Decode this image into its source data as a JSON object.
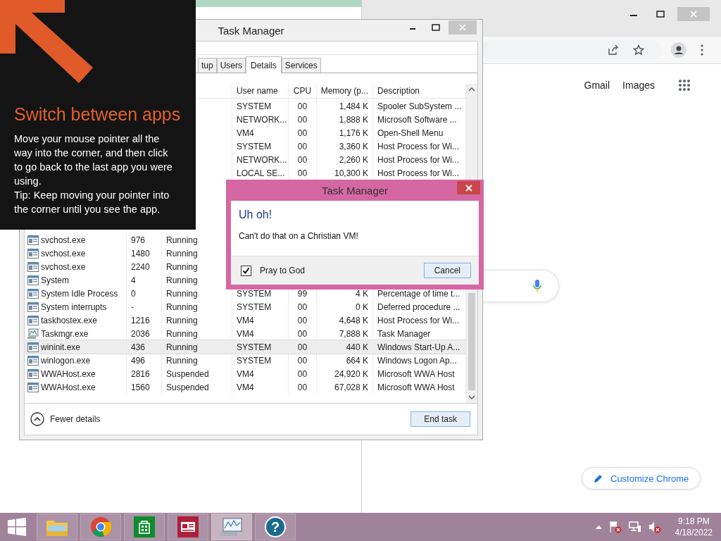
{
  "chrome": {
    "links": [
      "Gmail",
      "Images"
    ],
    "customize_button": "Customize Chrome"
  },
  "task_manager": {
    "title": "Task Manager",
    "tabs": [
      {
        "label": "tup",
        "selected": false
      },
      {
        "label": "Users",
        "selected": false
      },
      {
        "label": "Details",
        "selected": true
      },
      {
        "label": "Services",
        "selected": false
      }
    ],
    "columns": [
      "User name",
      "CPU",
      "Memory (p...",
      "Description"
    ],
    "rows": [
      {
        "user": "SYSTEM",
        "cpu": "00",
        "memory": "1,484 K",
        "description": "Spooler SubSystem ...",
        "selected": false
      },
      {
        "user": "NETWORK...",
        "cpu": "00",
        "memory": "1,888 K",
        "description": "Microsoft Software ...",
        "selected": false
      },
      {
        "user": "VM4",
        "cpu": "00",
        "memory": "1,176 K",
        "description": "Open-Shell Menu",
        "selected": false
      },
      {
        "user": "SYSTEM",
        "cpu": "00",
        "memory": "3,360 K",
        "description": "Host Process for Wi...",
        "selected": false
      },
      {
        "user": "NETWORK...",
        "cpu": "00",
        "memory": "2,260 K",
        "description": "Host Process for Wi...",
        "selected": false
      },
      {
        "user": "LOCAL SE...",
        "cpu": "00",
        "memory": "10,300 K",
        "description": "Host Process for Wi...",
        "selected": false
      },
      {
        "kind": "app",
        "name": "svchost.exe",
        "pid": "976",
        "status": "Running",
        "selected": false
      },
      {
        "kind": "app",
        "name": "svchost.exe",
        "pid": "1480",
        "status": "Running",
        "selected": false
      },
      {
        "kind": "app",
        "name": "svchost.exe",
        "pid": "2240",
        "status": "Running",
        "selected": false
      },
      {
        "kind": "app",
        "name": "System",
        "pid": "4",
        "status": "Running",
        "selected": false
      },
      {
        "kind": "app",
        "name": "System Idle Process",
        "pid": "0",
        "status": "Running",
        "user": "SYSTEM",
        "cpu": "99",
        "memory": "4 K",
        "description": "Percentage of time t...",
        "selected": false
      },
      {
        "kind": "app",
        "name": "System interrupts",
        "pid": "-",
        "status": "Running",
        "user": "SYSTEM",
        "cpu": "00",
        "memory": "0 K",
        "description": "Deferred procedure ...",
        "selected": false
      },
      {
        "kind": "app",
        "name": "taskhostex.exe",
        "pid": "1216",
        "status": "Running",
        "user": "VM4",
        "cpu": "00",
        "memory": "4,648 K",
        "description": "Host Process for Wi...",
        "selected": false
      },
      {
        "kind": "monitor",
        "name": "Taskmgr.exe",
        "pid": "2036",
        "status": "Running",
        "user": "VM4",
        "cpu": "00",
        "memory": "7,888 K",
        "description": "Task Manager",
        "selected": false
      },
      {
        "kind": "app",
        "name": "wininit.exe",
        "pid": "436",
        "status": "Running",
        "user": "SYSTEM",
        "cpu": "00",
        "memory": "440 K",
        "description": "Windows Start-Up A...",
        "selected": true
      },
      {
        "kind": "app",
        "name": "winlogon.exe",
        "pid": "496",
        "status": "Running",
        "user": "SYSTEM",
        "cpu": "00",
        "memory": "664 K",
        "description": "Windows Logon Ap...",
        "selected": false
      },
      {
        "kind": "app",
        "name": "WWAHost.exe",
        "pid": "2816",
        "status": "Suspended",
        "user": "VM4",
        "cpu": "00",
        "memory": "24,920 K",
        "description": "Microsoft WWA Host",
        "selected": false
      },
      {
        "kind": "app",
        "name": "WWAHost.exe",
        "pid": "1560",
        "status": "Suspended",
        "user": "VM4",
        "cpu": "00",
        "memory": "67,028 K",
        "description": "Microsoft WWA Host",
        "selected": false
      }
    ],
    "fewer_details": "Fewer details",
    "end_task": "End task"
  },
  "charm": {
    "title": "Switch between apps",
    "body": "Move your mouse pointer all the way into the corner, and then click to go back to the last app you were using.",
    "tip": "Tip: Keep moving your pointer into the corner until you see the app."
  },
  "dialog": {
    "title": "Task Manager",
    "heading": "Uh oh!",
    "message": "Can't do that on a Christian VM!",
    "checkbox": {
      "label": "Pray to God",
      "checked": true
    },
    "button": "Cancel"
  },
  "taskbar": {
    "items": [
      {
        "kind": "explorer",
        "selected": false
      },
      {
        "kind": "chrome",
        "selected": false
      },
      {
        "kind": "store",
        "selected": false
      },
      {
        "kind": "news",
        "selected": false
      },
      {
        "kind": "taskmgr",
        "selected": true
      },
      {
        "kind": "help",
        "glyph": "?",
        "selected": false
      }
    ],
    "time": "9:18 PM",
    "date": "4/18/2022"
  }
}
